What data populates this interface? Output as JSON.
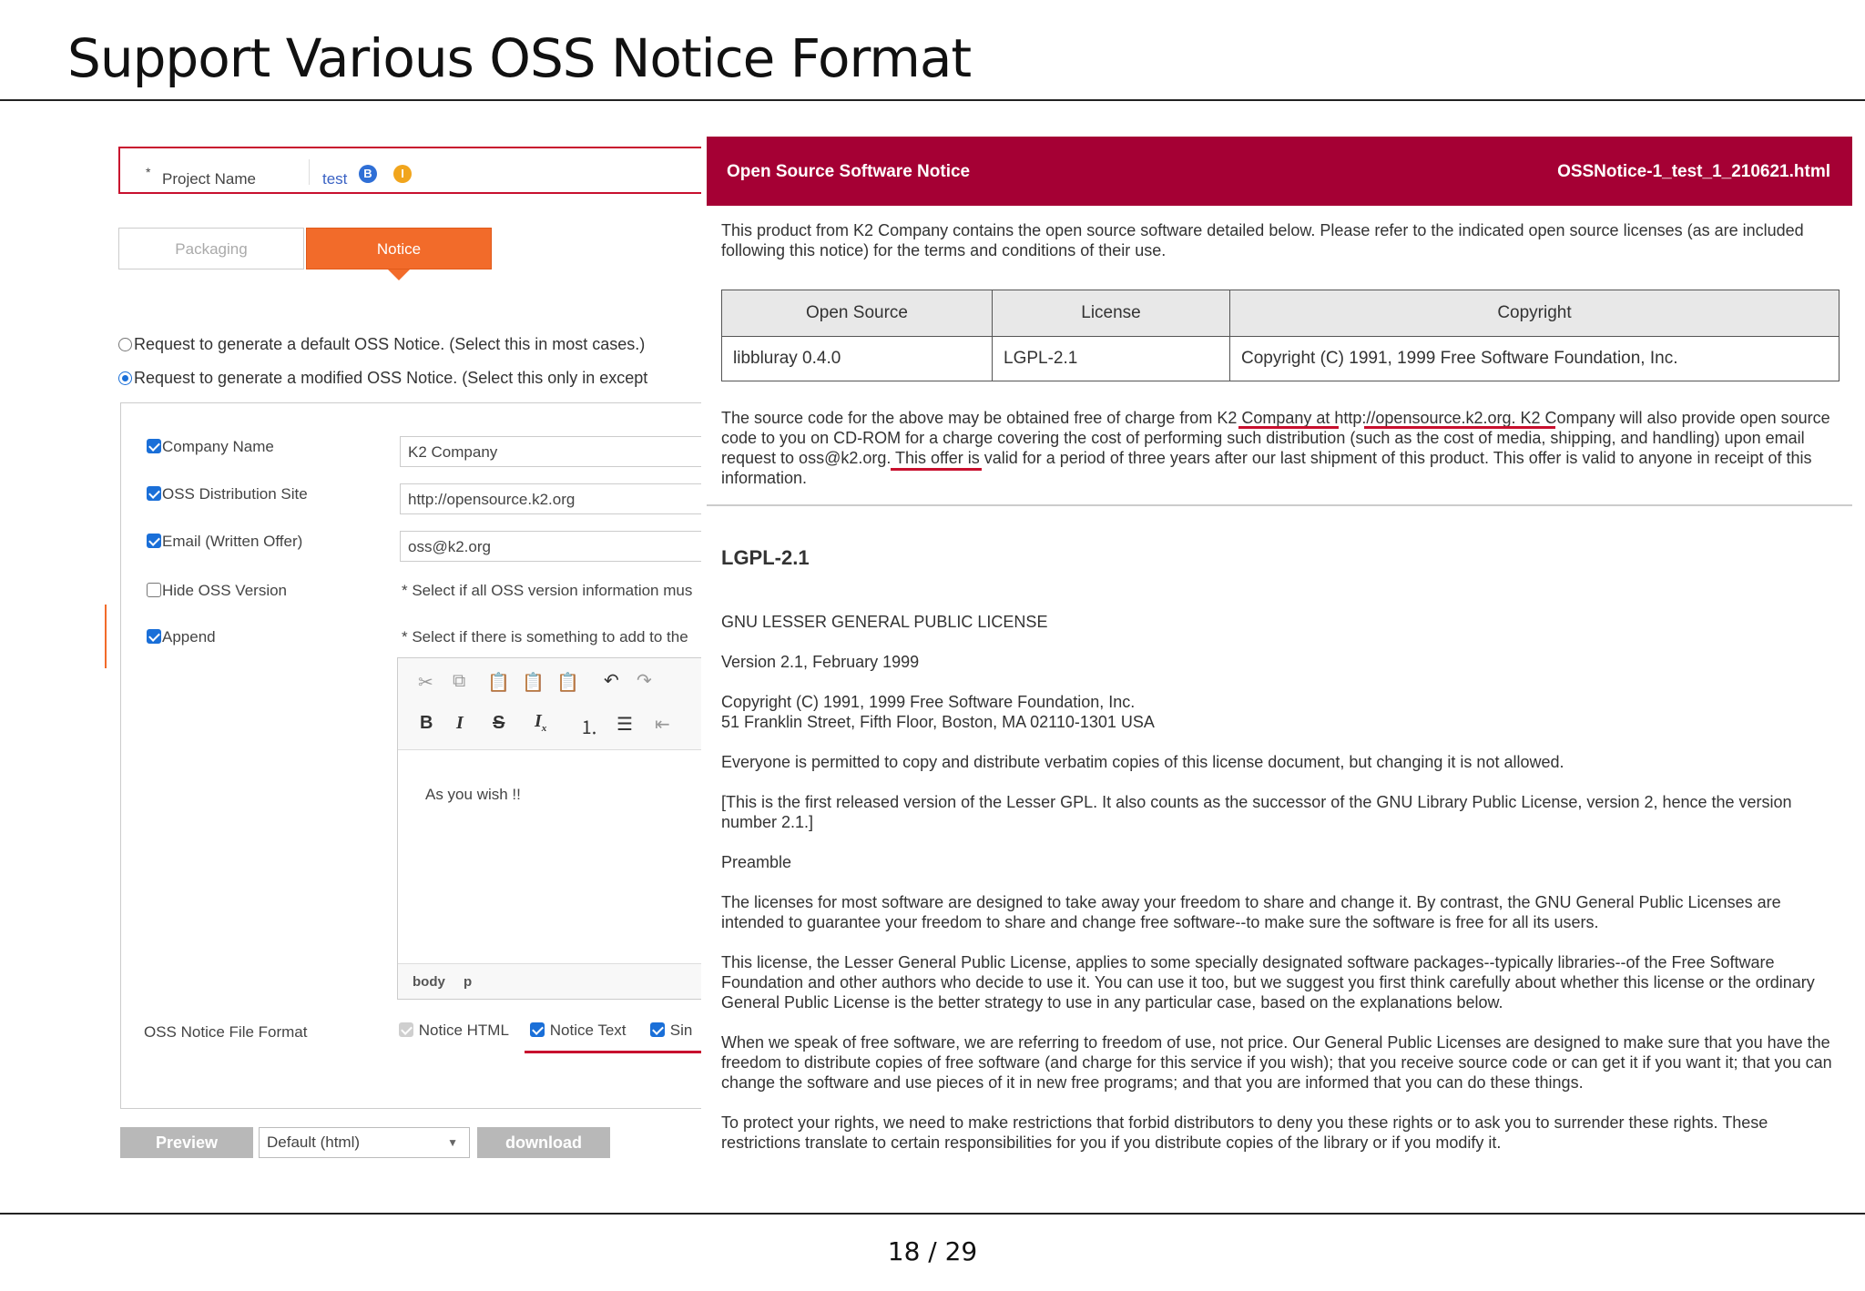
{
  "slide": {
    "title": "Support Various OSS Notice Format",
    "page_number": "18 / 29"
  },
  "form": {
    "project_name_label": "Project Name",
    "project_required_mark": "*",
    "project_name_value": "test",
    "badge_b": "B",
    "badge_i": "I",
    "tabs": [
      {
        "label": "Packaging",
        "active": false
      },
      {
        "label": "Notice",
        "active": true
      }
    ],
    "radio_default": "Request to generate a default OSS Notice. (Select this in most cases.)",
    "radio_modified": "Request to generate a modified OSS Notice. (Select this only in except",
    "selected_radio": "modified",
    "fields": {
      "company_name": {
        "label": "Company Name",
        "checked": true,
        "value": "K2 Company"
      },
      "oss_site": {
        "label": "OSS Distribution Site",
        "checked": true,
        "value": "http://opensource.k2.org"
      },
      "email": {
        "label": "Email (Written Offer)",
        "checked": true,
        "value": "oss@k2.org"
      },
      "hide_version": {
        "label": "Hide OSS Version",
        "checked": false,
        "note": "* Select if all OSS version information mus"
      },
      "append": {
        "label": "Append",
        "checked": true,
        "note": "* Select if there is something to add to the"
      }
    },
    "editor": {
      "content": "As you wish !!",
      "status_body": "body",
      "status_p": "p",
      "tool_bold": "B",
      "tool_italic": "I",
      "tool_strike": "S"
    },
    "file_format": {
      "label": "OSS Notice File Format",
      "options": [
        {
          "label": "Notice HTML",
          "checked": true,
          "disabled": true
        },
        {
          "label": "Notice Text",
          "checked": true
        },
        {
          "label": "Sin",
          "checked": true
        }
      ]
    },
    "buttons": {
      "preview": "Preview",
      "download": "download",
      "select_value": "Default (html)"
    }
  },
  "notice": {
    "header_title": "Open Source Software Notice",
    "header_file": "OSSNotice-1_test_1_210621.html",
    "intro": "This product from K2 Company contains the open source software detailed below. Please refer to the indicated open source licenses (as are included following this notice) for the terms and conditions of their use.",
    "table": {
      "headers": [
        "Open Source",
        "License",
        "Copyright"
      ],
      "rows": [
        [
          "libbluray 0.4.0",
          "LGPL-2.1",
          "Copyright (C) 1991, 1999 Free Software Foundation, Inc."
        ]
      ]
    },
    "source_offer": "The source code for the above may be obtained free of charge from K2 Company at http://opensource.k2.org. K2 Company will also provide open source code to you on CD-ROM for a charge covering the cost of performing such distribution (such as the cost of media, shipping, and handling) upon email request to oss@k2.org. This offer is valid for a period of three years after our last shipment of this product. This offer is valid to anyone in receipt of this information.",
    "license_title": "LGPL-2.1",
    "license_paragraphs": [
      "GNU LESSER GENERAL PUBLIC LICENSE",
      "Version 2.1, February 1999",
      "Copyright (C) 1991, 1999 Free Software Foundation, Inc.\n51 Franklin Street, Fifth Floor, Boston, MA 02110-1301 USA",
      "Everyone is permitted to copy and distribute verbatim copies of this license document, but changing it is not allowed.",
      "[This is the first released version of the Lesser GPL. It also counts as the successor of the GNU Library Public License, version 2, hence the version number 2.1.]",
      "Preamble",
      "The licenses for most software are designed to take away your freedom to share and change it. By contrast, the GNU General Public Licenses are intended to guarantee your freedom to share and change free software--to make sure the software is free for all its users.",
      "This license, the Lesser General Public License, applies to some specially designated software packages--typically libraries--of the Free Software Foundation and other authors who decide to use it. You can use it too, but we suggest you first think carefully about whether this license or the ordinary General Public License is the better strategy to use in any particular case, based on the explanations below.",
      "When we speak of free software, we are referring to freedom of use, not price. Our General Public Licenses are designed to make sure that you have the freedom to distribute copies of free software (and charge for this service if you wish); that you receive source code or can get it if you want it; that you can change the software and use pieces of it in new free programs; and that you are informed that you can do these things.",
      "To protect your rights, we need to make restrictions that forbid distributors to deny you these rights or to ask you to surrender these rights. These restrictions translate to certain responsibilities for you if you distribute copies of the library or if you modify it."
    ]
  },
  "colors": {
    "brand_header": "#a50034",
    "tab_active": "#f26b2a",
    "highlight_underline": "#c8102e",
    "checkbox": "#1a6fd8"
  },
  "icons": [
    "cut-icon",
    "copy-icon",
    "paste-icon",
    "paste-text-icon",
    "paste-word-icon",
    "undo-icon",
    "redo-icon",
    "bold-icon",
    "italic-icon",
    "strikethrough-icon",
    "remove-format-icon",
    "numbered-list-icon",
    "bulleted-list-icon",
    "outdent-icon",
    "dropdown-caret-icon"
  ]
}
